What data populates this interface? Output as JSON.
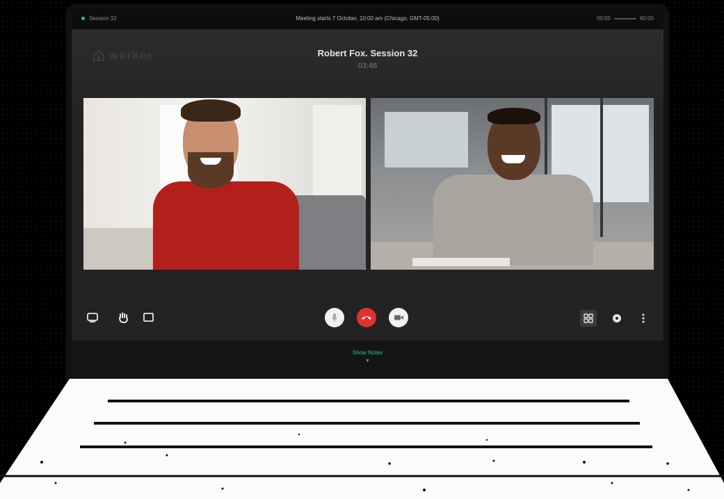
{
  "topbar": {
    "back_label": "Session 32",
    "meeting_info": "Meeting starts 7 October, 10:00 am (Chicago, GMT-05:00)",
    "time_start": "00:00",
    "time_end": "60:00"
  },
  "header": {
    "logo": "workee",
    "title": "Robert Fox. Session 32",
    "timer": "03:46"
  },
  "participants": [
    {
      "video": "participant-left"
    },
    {
      "video": "participant-right"
    }
  ],
  "controls": {
    "left": [
      "screen-share-icon",
      "raise-hand-icon",
      "fullscreen-icon"
    ],
    "center": [
      "microphone-icon",
      "end-call-icon",
      "camera-icon"
    ],
    "right": [
      "grid-view-icon",
      "settings-icon",
      "more-icon"
    ]
  },
  "footer": {
    "show_notes": "Show Notes"
  },
  "colors": {
    "accent": "#2ec27e",
    "end_call": "#e03131",
    "screen_bg": "#232323"
  }
}
